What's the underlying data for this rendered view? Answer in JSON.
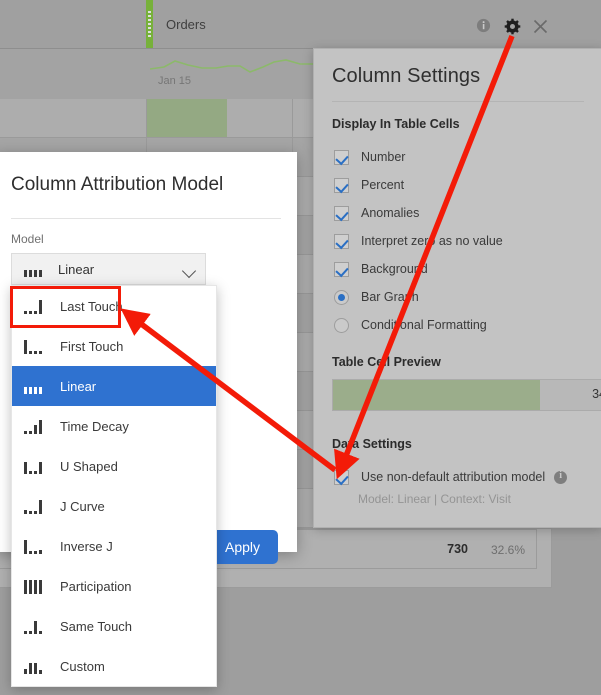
{
  "background": {
    "column_header_label": "Orders",
    "spark_axis_label": "Jan 15",
    "summary_row": {
      "number": "730",
      "percent": "32.6%"
    },
    "header_icons": [
      {
        "name": "info-icon",
        "glyph": "info"
      },
      {
        "name": "gear-icon",
        "glyph": "gear"
      },
      {
        "name": "close-icon",
        "glyph": "close"
      }
    ]
  },
  "column_settings": {
    "title": "Column Settings",
    "display_section_label": "Display In Table Cells",
    "checkboxes": [
      {
        "label": "Number",
        "checked": true
      },
      {
        "label": "Percent",
        "checked": true
      },
      {
        "label": "Anomalies",
        "checked": true
      },
      {
        "label": "Interpret zero as no value",
        "checked": true
      },
      {
        "label": "Background",
        "checked": true
      }
    ],
    "radios": [
      {
        "label": "Bar Graph",
        "selected": true
      },
      {
        "label": "Conditional Formatting",
        "selected": false
      }
    ],
    "preview_section_label": "Table Cell Preview",
    "preview_value": "34",
    "preview_fill_percent": 74,
    "data_section_label": "Data Settings",
    "attribution_toggle": {
      "label": "Use non-default attribution model",
      "checked": true,
      "info_icon": "info-icon"
    },
    "attribution_hint": "Model: Linear  |  Context: Visit"
  },
  "attribution_dialog": {
    "title": "Column Attribution Model",
    "field_label": "Model",
    "select_value": "Linear",
    "select_glyph": "linear",
    "apply_label": "Apply",
    "options": [
      {
        "label": "Last Touch",
        "glyph": "last-touch",
        "selected": false
      },
      {
        "label": "First Touch",
        "glyph": "first-touch",
        "selected": false
      },
      {
        "label": "Linear",
        "glyph": "linear",
        "selected": true
      },
      {
        "label": "Time Decay",
        "glyph": "time-decay",
        "selected": false
      },
      {
        "label": "U Shaped",
        "glyph": "u-shaped",
        "selected": false
      },
      {
        "label": "J Curve",
        "glyph": "j-curve",
        "selected": false
      },
      {
        "label": "Inverse J",
        "glyph": "inverse-j",
        "selected": false
      },
      {
        "label": "Participation",
        "glyph": "participation",
        "selected": false
      },
      {
        "label": "Same Touch",
        "glyph": "same-touch",
        "selected": false
      },
      {
        "label": "Custom",
        "glyph": "custom",
        "selected": false
      }
    ]
  },
  "colors": {
    "accent_blue": "#2f72d0",
    "annotation_red": "#f31b08",
    "green_bar": "#94a983",
    "sparkline_green": "#8cb96a",
    "panel_gray": "#c3c3c3"
  }
}
